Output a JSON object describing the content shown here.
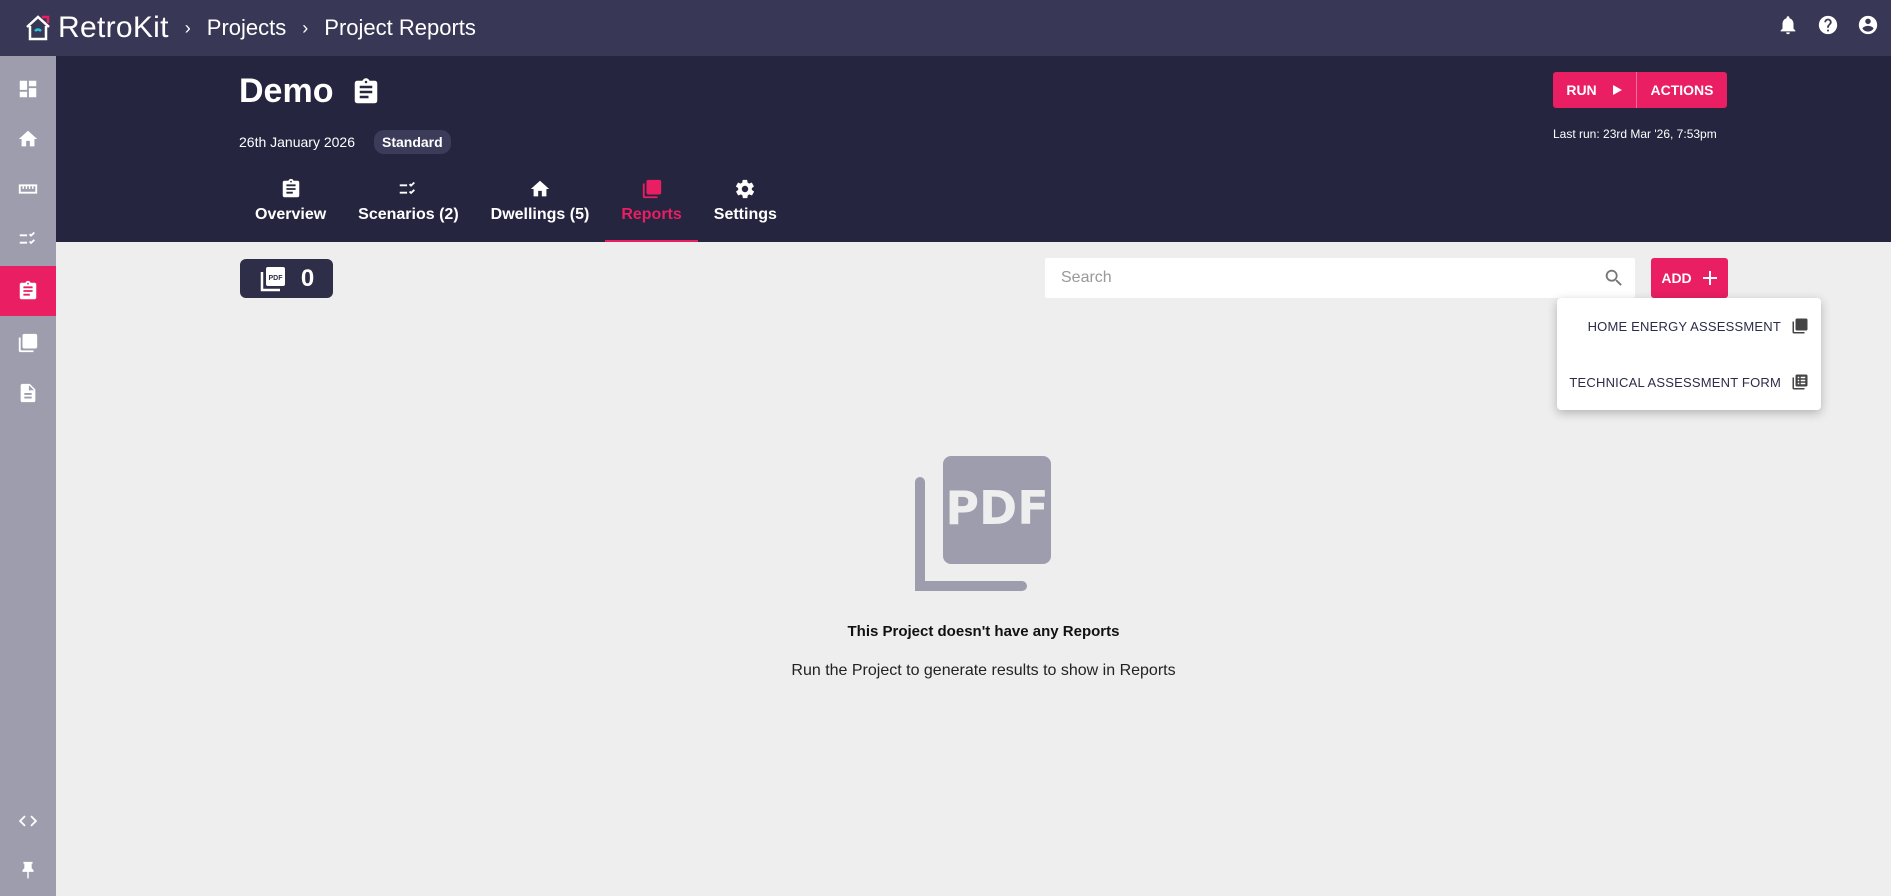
{
  "app": {
    "name": "RetroKit",
    "breadcrumbs": [
      "Projects",
      "Project Reports"
    ]
  },
  "colors": {
    "accent": "#e91e63",
    "topbar": "#383856",
    "header": "#25253f",
    "sidebar": "#9e9dae"
  },
  "project": {
    "title": "Demo",
    "date": "26th January 2026",
    "badge": "Standard",
    "run_label": "RUN",
    "actions_label": "ACTIONS",
    "last_run": "Last run: 23rd Mar '26, 7:53pm"
  },
  "tabs": [
    {
      "label": "Overview",
      "icon": "clipboard-icon"
    },
    {
      "label": "Scenarios (2)",
      "icon": "checklist-icon"
    },
    {
      "label": "Dwellings (5)",
      "icon": "home-icon"
    },
    {
      "label": "Reports",
      "icon": "pdf-icon",
      "active": true
    },
    {
      "label": "Settings",
      "icon": "gear-icon"
    }
  ],
  "reports": {
    "count": "0",
    "search_placeholder": "Search",
    "add_label": "ADD",
    "menu": [
      {
        "label": "HOME ENERGY ASSESSMENT",
        "icon": "pdf-icon"
      },
      {
        "label": "TECHNICAL ASSESSMENT FORM",
        "icon": "table-icon"
      }
    ],
    "empty_title": "This Project doesn't have any Reports",
    "empty_subtitle": "Run the Project to generate results to show in Reports"
  },
  "sidebar": {
    "items": [
      "dashboard-icon",
      "home-icon",
      "ruler-icon",
      "checklist-icon",
      "clipboard-icon",
      "pdf-icon",
      "document-icon",
      "code-icon",
      "pin-icon"
    ]
  }
}
